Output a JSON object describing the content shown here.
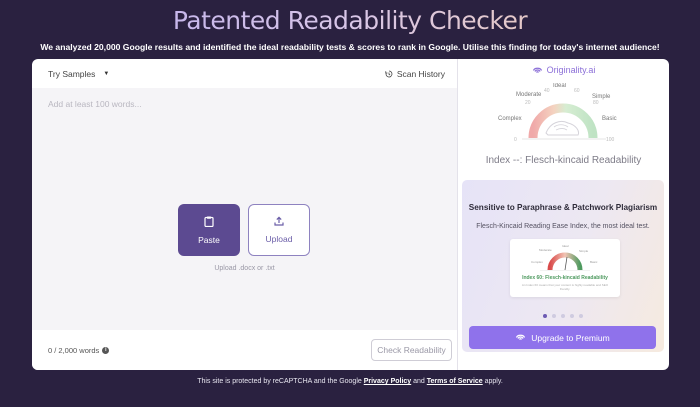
{
  "header": {
    "title": "Patented Readability Checker",
    "subtitle": "We analyzed 20,000 Google results and identified the ideal readability tests & scores to rank in Google. Utilise this finding for today's internet audience!"
  },
  "editor": {
    "try_samples_label": "Try Samples",
    "scan_history_label": "Scan History",
    "placeholder": "Add at least 100 words...",
    "paste_label": "Paste",
    "upload_label": "Upload",
    "upload_hint": "Upload .docx or .txt",
    "word_count": "0 / 2,000 words",
    "info_symbol": "i",
    "check_button_label": "Check Readability"
  },
  "sidebar": {
    "brand": "Originality.ai",
    "gauge": {
      "labels": {
        "ideal": "Ideal",
        "moderate": "Moderate",
        "simple": "Simple",
        "complex": "Complex",
        "basic": "Basic"
      },
      "ticks": {
        "t0": "0",
        "t20": "20",
        "t40": "40",
        "t60": "60",
        "t80": "80",
        "t100": "100"
      }
    },
    "index_label": "Index --: Flesch-kincaid Readability",
    "promo": {
      "title": "Sensitive to Paraphrase & Patchwork Plagiarism",
      "description": "Flesch-Kincaid Reading Ease Index, the most ideal test.",
      "mini_card": {
        "title": "Index 60: Flesch-kincaid Readability",
        "description": "An Index 60 means that your content is highly readable and SEO friendly.",
        "labels": {
          "ideal": "Ideal",
          "moderate": "Moderate",
          "simple": "Simple",
          "complex": "Complex",
          "basic": "Basic"
        }
      },
      "carousel": {
        "count": 5,
        "active_index": 0
      },
      "upgrade_label": "Upgrade to Premium"
    }
  },
  "footer": {
    "text_before": "This site is protected by reCAPTCHA and the Google ",
    "privacy_link": "Privacy Policy",
    "text_mid": " and ",
    "terms_link": "Terms of Service",
    "text_after": " apply."
  },
  "colors": {
    "background": "#2a2140",
    "paste_button": "#5c4a91",
    "upgrade_button": "#8f72eb",
    "brand": "#8c70d8",
    "gauge_red": "#f0a9a9",
    "gauge_green": "#bfe3c4",
    "mini_green": "#4e9a5f"
  }
}
